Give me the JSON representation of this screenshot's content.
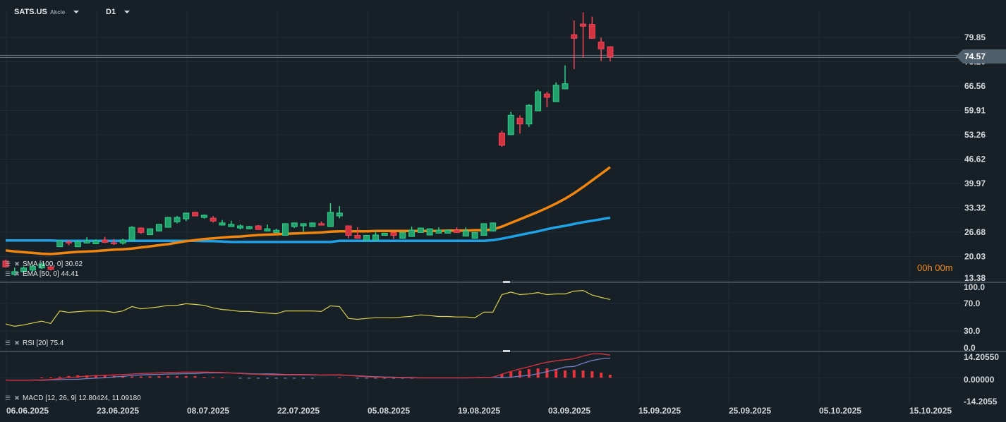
{
  "header": {
    "symbol": "SATS.US",
    "instrument_type": "Akcie",
    "timeframe": "D1"
  },
  "colors": {
    "background": "#172027",
    "grid": "#212b33",
    "bull": "#23a06b",
    "bull_border": "#2fd08a",
    "bear": "#d13341",
    "bear_border": "#f2475a",
    "sma": "#1ea1e6",
    "ema": "#f0850f",
    "rsi": "#d9cf4f",
    "macd": "#d8323f",
    "signal": "#7280c4"
  },
  "price_axis": {
    "labels": [
      "79.85",
      "73.20",
      "66.56",
      "59.91",
      "53.26",
      "46.62",
      "39.97",
      "33.32",
      "26.68",
      "20.03",
      "13.38"
    ],
    "current_price": "74.57"
  },
  "rsi_axis": {
    "labels": [
      "100.0",
      "70.0",
      "30.0",
      "0.0"
    ]
  },
  "macd_axis": {
    "labels": [
      "14.20550",
      "0.00000",
      "-14.2055"
    ]
  },
  "time_axis": {
    "labels": [
      "06.06.2025",
      "23.06.2025",
      "08.07.2025",
      "22.07.2025",
      "05.08.2025",
      "19.08.2025",
      "03.09.2025",
      "15.09.2025",
      "25.09.2025",
      "05.10.2025",
      "15.10.2025"
    ]
  },
  "legends": {
    "sma": "SMA [100, 0] 30.62",
    "ema": "EMA [50, 0] 44.41",
    "rsi": "RSI [20]  75.4",
    "macd": "MACD [12, 26, 9] 12.80424,  11.09180"
  },
  "countdown": "00h 00m",
  "chart_data": [
    {
      "type": "candlestick",
      "title": "SATS.US D1",
      "ohlc": [
        [
          18.8,
          19.2,
          17.0,
          17.2
        ],
        [
          15.1,
          17.0,
          14.8,
          15.9
        ],
        [
          15.9,
          17.3,
          15.6,
          16.9
        ],
        [
          16.3,
          17.6,
          16.0,
          17.3
        ],
        [
          16.9,
          18.4,
          16.6,
          18.0
        ],
        [
          17.2,
          17.6,
          16.2,
          16.5
        ],
        [
          22.7,
          24.4,
          22.6,
          24.3
        ],
        [
          24.0,
          24.5,
          23.1,
          23.8
        ],
        [
          22.7,
          24.5,
          22.6,
          24.1
        ],
        [
          23.7,
          25.3,
          23.6,
          24.3
        ],
        [
          23.5,
          24.7,
          23.4,
          24.3
        ],
        [
          24.5,
          25.4,
          23.7,
          23.9
        ],
        [
          23.8,
          24.8,
          23.2,
          23.6
        ],
        [
          23.7,
          24.9,
          23.3,
          24.5
        ],
        [
          24.5,
          28.3,
          24.4,
          28.0
        ],
        [
          27.8,
          28.0,
          26.2,
          26.6
        ],
        [
          26.0,
          27.7,
          25.9,
          27.6
        ],
        [
          27.0,
          28.9,
          26.9,
          28.8
        ],
        [
          28.0,
          30.8,
          27.9,
          30.7
        ],
        [
          29.5,
          31.1,
          29.1,
          30.7
        ],
        [
          30.3,
          31.9,
          29.7,
          31.9
        ],
        [
          32.1,
          32.2,
          31.0,
          31.1
        ],
        [
          30.7,
          31.5,
          30.4,
          31.3
        ],
        [
          30.5,
          31.1,
          29.3,
          29.7
        ],
        [
          28.6,
          30.0,
          28.5,
          29.2
        ],
        [
          28.2,
          29.8,
          28.1,
          28.8
        ],
        [
          27.8,
          28.8,
          27.4,
          28.4
        ],
        [
          27.6,
          28.4,
          27.5,
          28.2
        ],
        [
          28.4,
          28.6,
          27.3,
          27.4
        ],
        [
          27.0,
          28.8,
          26.9,
          27.6
        ],
        [
          26.6,
          27.6,
          26.5,
          27.2
        ],
        [
          25.8,
          29.1,
          25.7,
          29.0
        ],
        [
          28.2,
          29.3,
          27.8,
          29.2
        ],
        [
          28.4,
          29.1,
          26.8,
          29.0
        ],
        [
          28.2,
          29.3,
          28.1,
          29.2
        ],
        [
          29.0,
          29.6,
          28.5,
          28.6
        ],
        [
          28.2,
          34.6,
          28.1,
          32.1
        ],
        [
          31.1,
          33.8,
          30.5,
          31.9
        ],
        [
          28.4,
          28.5,
          25.0,
          25.8
        ],
        [
          25.8,
          28.0,
          25.0,
          25.0
        ],
        [
          24.5,
          25.9,
          24.4,
          25.8
        ],
        [
          24.5,
          27.0,
          24.4,
          25.9
        ],
        [
          25.8,
          26.5,
          25.7,
          26.4
        ],
        [
          26.6,
          26.7,
          24.8,
          25.8
        ],
        [
          25.0,
          26.7,
          24.9,
          26.6
        ],
        [
          25.5,
          28.2,
          25.4,
          27.2
        ],
        [
          26.6,
          27.9,
          26.5,
          27.8
        ],
        [
          25.9,
          27.7,
          25.8,
          27.6
        ],
        [
          26.4,
          28.0,
          26.3,
          27.2
        ],
        [
          26.4,
          27.3,
          26.3,
          27.2
        ],
        [
          27.2,
          28.0,
          26.5,
          26.6
        ],
        [
          25.6,
          28.0,
          25.5,
          27.0
        ],
        [
          25.0,
          26.7,
          24.9,
          26.6
        ],
        [
          25.8,
          29.1,
          25.7,
          29.0
        ],
        [
          27.0,
          29.3,
          26.9,
          29.2
        ],
        [
          53.7,
          54.4,
          50.0,
          50.4
        ],
        [
          53.3,
          59.5,
          53.2,
          58.6
        ],
        [
          57.8,
          58.6,
          53.6,
          56.2
        ],
        [
          56.2,
          61.6,
          55.4,
          61.3
        ],
        [
          59.8,
          65.6,
          59.7,
          65.0
        ],
        [
          64.4,
          65.0,
          60.8,
          63.5
        ],
        [
          62.3,
          67.6,
          62.2,
          66.8
        ],
        [
          65.8,
          72.2,
          65.7,
          67.2
        ],
        [
          80.6,
          84.5,
          71.2,
          79.6
        ],
        [
          83.5,
          86.7,
          74.3,
          82.9
        ],
        [
          83.4,
          85.5,
          79.5,
          79.6
        ],
        [
          78.6,
          79.8,
          73.4,
          76.7
        ],
        [
          77.3,
          77.4,
          73.3,
          74.57
        ]
      ],
      "sma_100": [
        24.4,
        24.4,
        24.4,
        24.4,
        24.4,
        24.4,
        24.3,
        24.3,
        24.3,
        24.3,
        24.3,
        24.3,
        24.3,
        24.3,
        24.3,
        24.3,
        24.3,
        24.3,
        24.3,
        24.3,
        24.3,
        24.3,
        24.2,
        24.2,
        24.1,
        24.0,
        24.0,
        24.0,
        24.0,
        24.0,
        24.0,
        24.0,
        24.0,
        24.0,
        24.0,
        24.0,
        24.0,
        24.3,
        24.3,
        24.3,
        24.3,
        24.3,
        24.3,
        24.3,
        24.3,
        24.3,
        24.3,
        24.3,
        24.3,
        24.3,
        24.3,
        24.3,
        24.3,
        24.3,
        24.5,
        24.9,
        25.4,
        25.9,
        26.4,
        26.9,
        27.5,
        28.0,
        28.4,
        28.9,
        29.4,
        29.8,
        30.2,
        30.62
      ],
      "ema_50": [
        21.7,
        21.4,
        21.2,
        21.0,
        20.8,
        20.7,
        20.9,
        21.1,
        21.3,
        21.4,
        21.5,
        21.7,
        21.9,
        22.0,
        22.2,
        22.5,
        22.8,
        23.1,
        23.4,
        23.8,
        24.2,
        24.5,
        24.8,
        25.0,
        25.2,
        25.4,
        25.5,
        25.7,
        25.9,
        26.0,
        26.1,
        26.2,
        26.3,
        26.4,
        26.5,
        26.6,
        26.8,
        26.9,
        26.9,
        26.9,
        26.9,
        27.0,
        27.0,
        27.0,
        27.0,
        27.0,
        27.0,
        27.0,
        27.0,
        27.1,
        27.1,
        27.1,
        27.2,
        27.2,
        27.4,
        28.2,
        29.2,
        30.2,
        31.2,
        32.2,
        33.3,
        34.5,
        35.8,
        37.3,
        39.0,
        40.8,
        42.6,
        44.41
      ],
      "yrange": [
        13.38,
        86.5
      ]
    },
    {
      "type": "line",
      "title": "RSI [20]",
      "ylim": [
        0,
        100
      ],
      "values": [
        40.3,
        37,
        39,
        41.7,
        44.3,
        41,
        59,
        57,
        58,
        59,
        59,
        59,
        56.7,
        59,
        65.3,
        62,
        63.3,
        64.7,
        67,
        67,
        69.3,
        68.3,
        67,
        63.3,
        61,
        60,
        58.3,
        58.3,
        57,
        56,
        55,
        59,
        59,
        59,
        59,
        58.3,
        66.3,
        65.3,
        48.3,
        47,
        48.3,
        49.3,
        49.3,
        49.3,
        50.3,
        51.3,
        53.3,
        52.3,
        51,
        51,
        50.3,
        50.3,
        49.3,
        57.3,
        57.3,
        82.3,
        86,
        82.3,
        83.3,
        85.3,
        82.3,
        83.3,
        83.3,
        87.3,
        88.3,
        81.7,
        78.3,
        75.4
      ]
    },
    {
      "type": "line+bar",
      "title": "MACD [12, 26, 9]",
      "ylim": [
        -14.2055,
        14.2055
      ],
      "macd": [
        -1.3,
        -1.4,
        -1.4,
        -1.3,
        -1.2,
        -1.0,
        -0.5,
        0.1,
        0.5,
        0.9,
        1.2,
        1.4,
        1.6,
        1.8,
        2.1,
        2.4,
        2.6,
        2.8,
        3.0,
        3.1,
        3.2,
        3.2,
        3.2,
        3.1,
        3.0,
        2.7,
        2.4,
        2.1,
        1.9,
        1.7,
        1.6,
        1.6,
        1.6,
        1.6,
        1.5,
        1.5,
        1.6,
        1.7,
        1.3,
        0.9,
        0.6,
        0.4,
        0.2,
        0.1,
        0.0,
        -0.1,
        -0.1,
        -0.1,
        -0.1,
        -0.1,
        -0.1,
        -0.1,
        0.0,
        0.2,
        0.3,
        2.0,
        3.6,
        5.0,
        6.2,
        7.6,
        8.8,
        9.6,
        10.2,
        10.8,
        12.3,
        13.5,
        13.6,
        12.8
      ],
      "signal": [
        -1.3,
        -1.4,
        -1.4,
        -1.3,
        -1.4,
        -1.2,
        -1.1,
        -0.9,
        -0.9,
        -0.5,
        -0.2,
        0.0,
        0.5,
        0.7,
        1.3,
        1.6,
        1.8,
        1.9,
        2.1,
        2.2,
        2.3,
        2.3,
        2.7,
        2.8,
        2.8,
        2.7,
        2.6,
        2.3,
        2.1,
        2.2,
        2.1,
        1.8,
        1.8,
        1.8,
        1.7,
        1.5,
        1.6,
        1.5,
        1.3,
        1.1,
        0.8,
        0.6,
        0.4,
        0.3,
        0.2,
        0.1,
        -0.1,
        -0.1,
        -0.1,
        -0.1,
        -0.1,
        -0.1,
        0.0,
        0.2,
        0.3,
        0.0,
        0.3,
        0.9,
        1.3,
        2.3,
        3.5,
        4.7,
        6.1,
        6.4,
        8.2,
        9.8,
        10.7,
        11.1
      ],
      "histogram": [
        0,
        0,
        0,
        0,
        0.2,
        0.2,
        0.6,
        1.0,
        1.4,
        1.4,
        1.4,
        1.4,
        1.1,
        1.1,
        0.8,
        0.8,
        0.8,
        0.9,
        0.9,
        0.9,
        0.9,
        0.9,
        0.5,
        0.3,
        0.2,
        0,
        -0.2,
        -0.2,
        -0.2,
        -0.5,
        -0.5,
        -0.2,
        -0.2,
        -0.2,
        -0.2,
        0,
        0,
        0.2,
        0,
        -0.2,
        -0.2,
        -0.2,
        -0.2,
        -0.2,
        -0.2,
        -0.2,
        0,
        0,
        0,
        0,
        0,
        0,
        0,
        0,
        0,
        2.0,
        3.3,
        4.1,
        4.9,
        5.3,
        5.3,
        4.9,
        4.1,
        4.4,
        4.1,
        3.7,
        2.9,
        1.7
      ]
    }
  ]
}
